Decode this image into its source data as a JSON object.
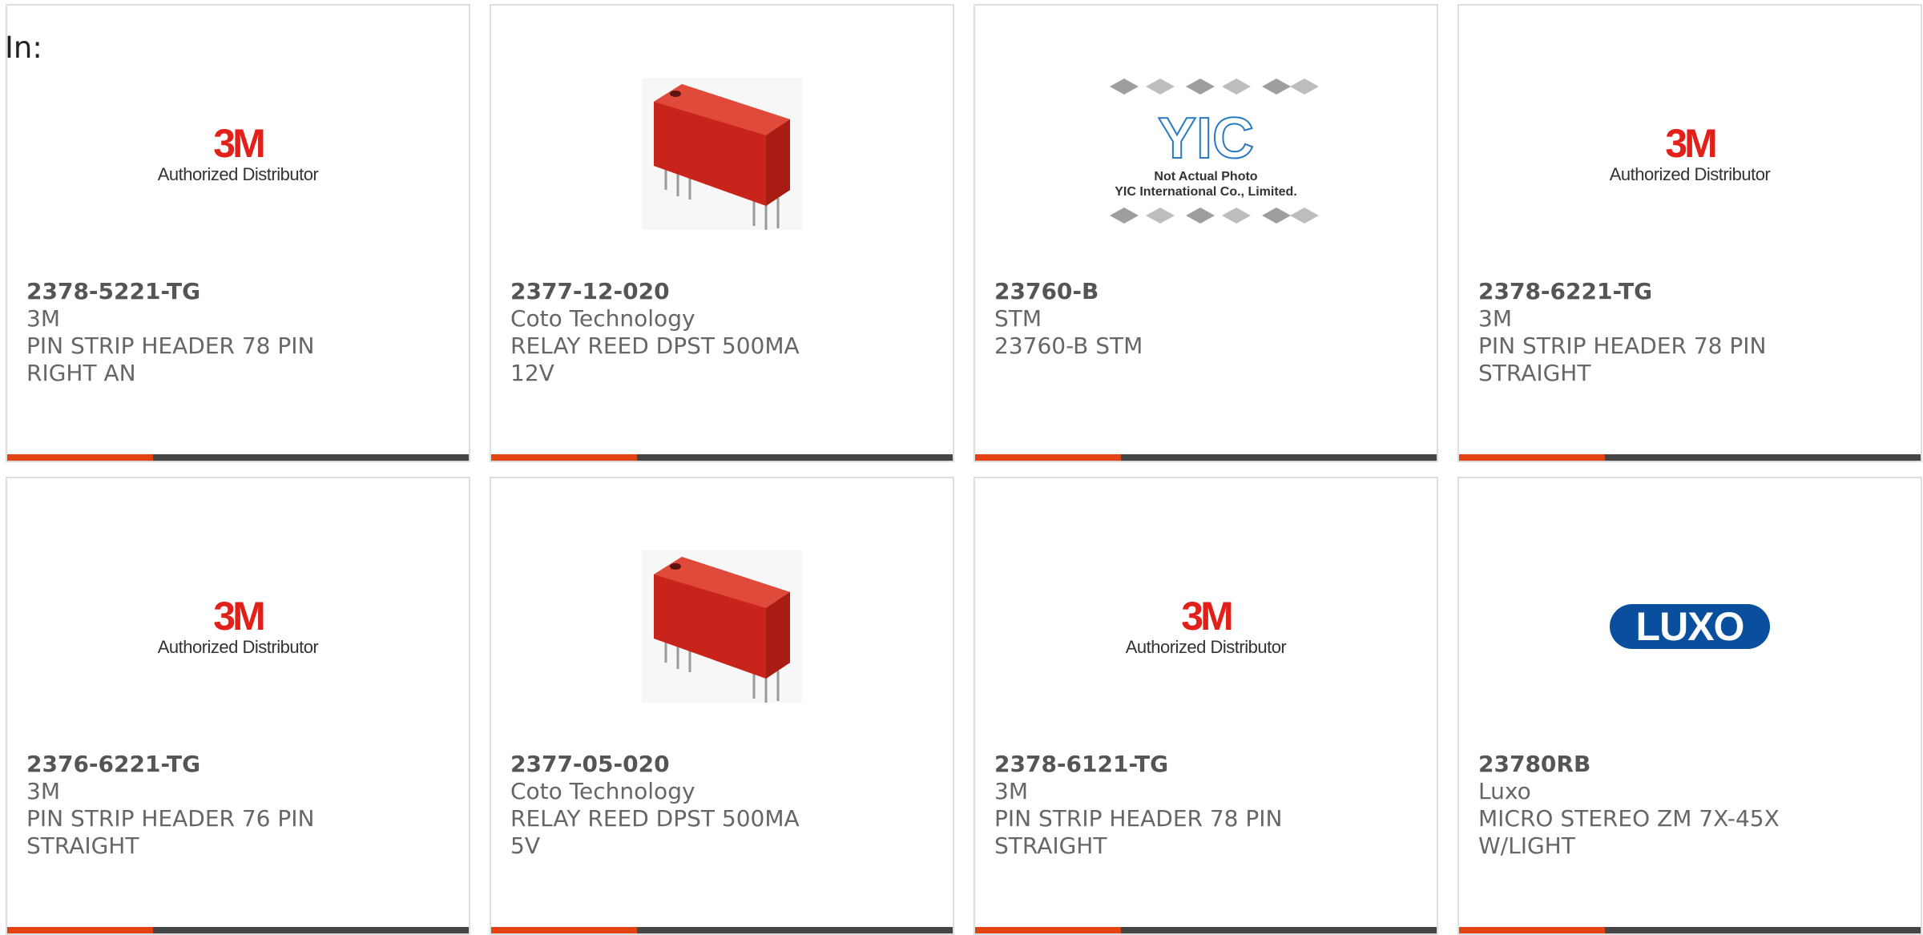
{
  "filter": {
    "label": "In:"
  },
  "products": [
    {
      "part_number": "2378-5221-TG",
      "manufacturer": "3M",
      "description": "PIN STRIP HEADER 78 PIN RIGHT AN",
      "image": "3m-logo"
    },
    {
      "part_number": "2377-12-020",
      "manufacturer": "Coto Technology",
      "description": "RELAY REED DPST 500MA 12V",
      "image": "relay"
    },
    {
      "part_number": "23760-B",
      "manufacturer": "STM",
      "description": "23760-B STM",
      "image": "yic-placeholder"
    },
    {
      "part_number": "2378-6221-TG",
      "manufacturer": "3M",
      "description": "PIN STRIP HEADER 78 PIN STRAIGHT",
      "image": "3m-logo"
    },
    {
      "part_number": "2376-6221-TG",
      "manufacturer": "3M",
      "description": "PIN STRIP HEADER 76 PIN STRAIGHT",
      "image": "3m-logo"
    },
    {
      "part_number": "2377-05-020",
      "manufacturer": "Coto Technology",
      "description": "RELAY REED DPST 500MA 5V",
      "image": "relay"
    },
    {
      "part_number": "2378-6121-TG",
      "manufacturer": "3M",
      "description": "PIN STRIP HEADER 78 PIN STRAIGHT",
      "image": "3m-logo"
    },
    {
      "part_number": "23780RB",
      "manufacturer": "Luxo",
      "description": "MICRO STEREO ZM 7X-45X W/LIGHT",
      "image": "luxo-logo"
    }
  ],
  "logos": {
    "three_m": {
      "mark": "3M",
      "sub": "Authorized Distributor"
    },
    "luxo": {
      "mark": "LUXO"
    },
    "yic": {
      "mark": "YIC",
      "caption_1": "Not Actual Photo",
      "caption_2": "YIC International Co., Limited."
    }
  },
  "colors": {
    "accent": "#e24312",
    "bar": "#454545",
    "brand_3m": "#e2201a",
    "luxo_blue": "#0a4f9e",
    "relay_red": "#cf2a20"
  }
}
